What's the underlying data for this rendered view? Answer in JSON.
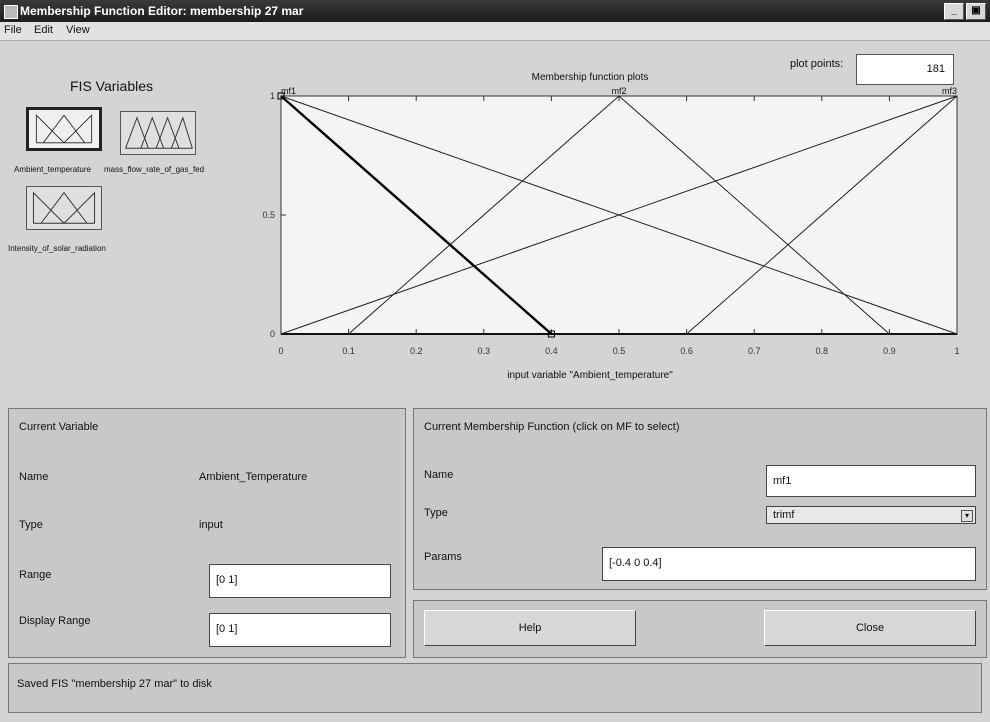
{
  "window": {
    "title": "Membership Function Editor: membership 27 mar",
    "min_label": "_",
    "max_label": "▣"
  },
  "menu": {
    "file": "File",
    "edit": "Edit",
    "view": "View"
  },
  "plot_points": {
    "label": "plot points:",
    "value": "181"
  },
  "fis_variables": {
    "title": "FIS Variables",
    "items": [
      {
        "label": "Ambient_temperature",
        "selected": true
      },
      {
        "label": "mass_flow_rate_of_gas_fed",
        "selected": false
      },
      {
        "label": "Intensity_of_solar_radiation",
        "selected": false
      }
    ]
  },
  "plot": {
    "title": "Membership function plots",
    "xlabel": "input variable \"Ambient_temperature\"",
    "mf_names": [
      "mf1",
      "mf2",
      "mf3"
    ],
    "x_ticks": [
      "0",
      "0.1",
      "0.2",
      "0.3",
      "0.4",
      "0.5",
      "0.6",
      "0.7",
      "0.8",
      "0.9",
      "1"
    ],
    "y_ticks": [
      "0",
      "0.5",
      "1"
    ]
  },
  "chart_data": {
    "type": "line",
    "title": "Membership function plots",
    "xlabel": "input variable \"Ambient_temperature\"",
    "ylabel": "",
    "xlim": [
      0,
      1
    ],
    "ylim": [
      0,
      1
    ],
    "series": [
      {
        "name": "mf1",
        "x": [
          0,
          0.4
        ],
        "y": [
          1,
          0
        ],
        "selected": true
      },
      {
        "name": "mf2",
        "x": [
          0.1,
          0.5,
          0.9
        ],
        "y": [
          0,
          1,
          0
        ]
      },
      {
        "name": "mf3",
        "x": [
          0.6,
          1
        ],
        "y": [
          0,
          1
        ]
      },
      {
        "name": "",
        "x": [
          0,
          1
        ],
        "y": [
          1,
          0
        ]
      },
      {
        "name": "",
        "x": [
          0,
          1
        ],
        "y": [
          0,
          1
        ]
      }
    ]
  },
  "current_variable": {
    "title": "Current Variable",
    "name_label": "Name",
    "name_value": "Ambient_Temperature",
    "type_label": "Type",
    "type_value": "input",
    "range_label": "Range",
    "range_value": "[0 1]",
    "display_range_label": "Display Range",
    "display_range_value": "[0 1]"
  },
  "current_mf": {
    "title": "Current Membership Function (click on MF to select)",
    "name_label": "Name",
    "name_value": "mf1",
    "type_label": "Type",
    "type_value": "trimf",
    "params_label": "Params",
    "params_value": "[-0.4 0 0.4]"
  },
  "buttons": {
    "help": "Help",
    "close": "Close"
  },
  "status": {
    "text": "Saved FIS \"membership 27 mar\" to disk"
  },
  "colors": {
    "selected_mf": "#000000",
    "mf_line": "#222222",
    "plot_bg": "#f4f4f4"
  }
}
